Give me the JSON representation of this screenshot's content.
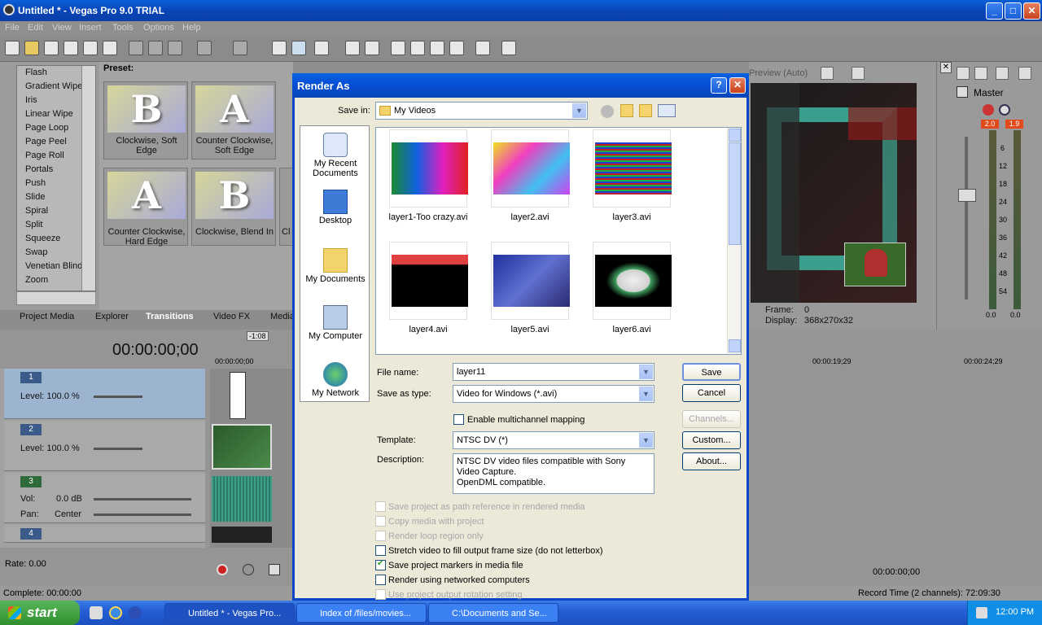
{
  "window": {
    "title": "Untitled * - Vegas Pro 9.0 TRIAL",
    "min": "_",
    "max": "□",
    "close": "✕"
  },
  "menu": [
    "File",
    "Edit",
    "View",
    "Insert",
    "Tools",
    "Options",
    "Help"
  ],
  "transitions": [
    "Flash",
    "Gradient Wipe",
    "Iris",
    "Linear Wipe",
    "Page Loop",
    "Page Peel",
    "Page Roll",
    "Portals",
    "Push",
    "Slide",
    "Spiral",
    "Split",
    "Squeeze",
    "Swap",
    "Venetian Blinds",
    "Zoom"
  ],
  "preset": {
    "heading": "Preset:",
    "items": [
      {
        "glyph": "B",
        "label": "Clockwise, Soft Edge"
      },
      {
        "glyph": "A",
        "label": "Counter Clockwise, Soft Edge"
      },
      {
        "glyph": "A",
        "label": "Counter Clockwise, Hard Edge"
      },
      {
        "glyph": "B",
        "label": "Clockwise, Blend In"
      }
    ],
    "cut_label": "Cl"
  },
  "tabs": [
    "Project Media",
    "Explorer",
    "Transitions",
    "Video FX",
    "Media"
  ],
  "preview": {
    "mode": "Preview (Auto)",
    "frame_label": "Frame:",
    "frame_value": "0",
    "display_label": "Display:",
    "display_value": "368x270x32"
  },
  "mixer": {
    "title": "Master",
    "peak_left": "2.0",
    "peak_right": "1.9",
    "scale": [
      "6",
      "12",
      "18",
      "24",
      "30",
      "36",
      "42",
      "48",
      "54"
    ],
    "left_val": "0.0",
    "right_val": "0.0"
  },
  "timeline": {
    "timecode": "00:00:00;00",
    "cursor_marker": "-1:08",
    "ruler": [
      "00:00:00;00",
      "00:00:19;29",
      "00:00:24;29"
    ],
    "tracks": [
      {
        "num": "1",
        "line1": "Level: 100.0 %"
      },
      {
        "num": "2",
        "line1": "Level: 100.0 %"
      },
      {
        "num": "3",
        "vol_label": "Vol:",
        "vol_value": "0.0 dB",
        "pan_label": "Pan:",
        "pan_value": "Center"
      },
      {
        "num": "4"
      }
    ],
    "rate": "Rate: 0.00",
    "end_time": "00:00:00;00"
  },
  "status": {
    "complete": "Complete: 00:00:00",
    "record_time": "Record Time (2 channels): 72:09:30"
  },
  "dialog": {
    "title": "Render As",
    "help": "?",
    "close": "✕",
    "save_in_label": "Save in:",
    "save_in_value": "My Videos",
    "places": [
      "My Recent Documents",
      "Desktop",
      "My Documents",
      "My Computer",
      "My Network"
    ],
    "files": [
      "layer1-Too crazy.avi",
      "layer2.avi",
      "layer3.avi",
      "layer4.avi",
      "layer5.avi",
      "layer6.avi"
    ],
    "file_name_label": "File name:",
    "file_name_value": "layer11",
    "save_as_type_label": "Save as type:",
    "save_as_type_value": "Video for Windows (*.avi)",
    "multichannel": "Enable multichannel mapping",
    "template_label": "Template:",
    "template_value": "NTSC DV (*)",
    "description_label": "Description:",
    "description_value": "NTSC DV video files compatible with Sony Video Capture.\nOpenDML compatible.",
    "buttons": {
      "save": "Save",
      "cancel": "Cancel",
      "channels": "Channels...",
      "custom": "Custom...",
      "about": "About..."
    },
    "options": [
      {
        "label": "Save project as path reference in rendered media",
        "checked": false,
        "disabled": true
      },
      {
        "label": "Copy media with project",
        "checked": false,
        "disabled": true
      },
      {
        "label": "Render loop region only",
        "checked": false,
        "disabled": true
      },
      {
        "label": "Stretch video to fill output frame size (do not letterbox)",
        "checked": false,
        "disabled": false
      },
      {
        "label": "Save project markers in media file",
        "checked": true,
        "disabled": false
      },
      {
        "label": "Render using networked computers",
        "checked": false,
        "disabled": false
      },
      {
        "label": "Use project output rotation setting",
        "checked": false,
        "disabled": true
      }
    ]
  },
  "taskbar": {
    "start": "start",
    "items": [
      "Untitled * - Vegas Pro...",
      "Index of /files/movies...",
      "C:\\Documents and Se..."
    ],
    "clock": "12:00 PM"
  }
}
